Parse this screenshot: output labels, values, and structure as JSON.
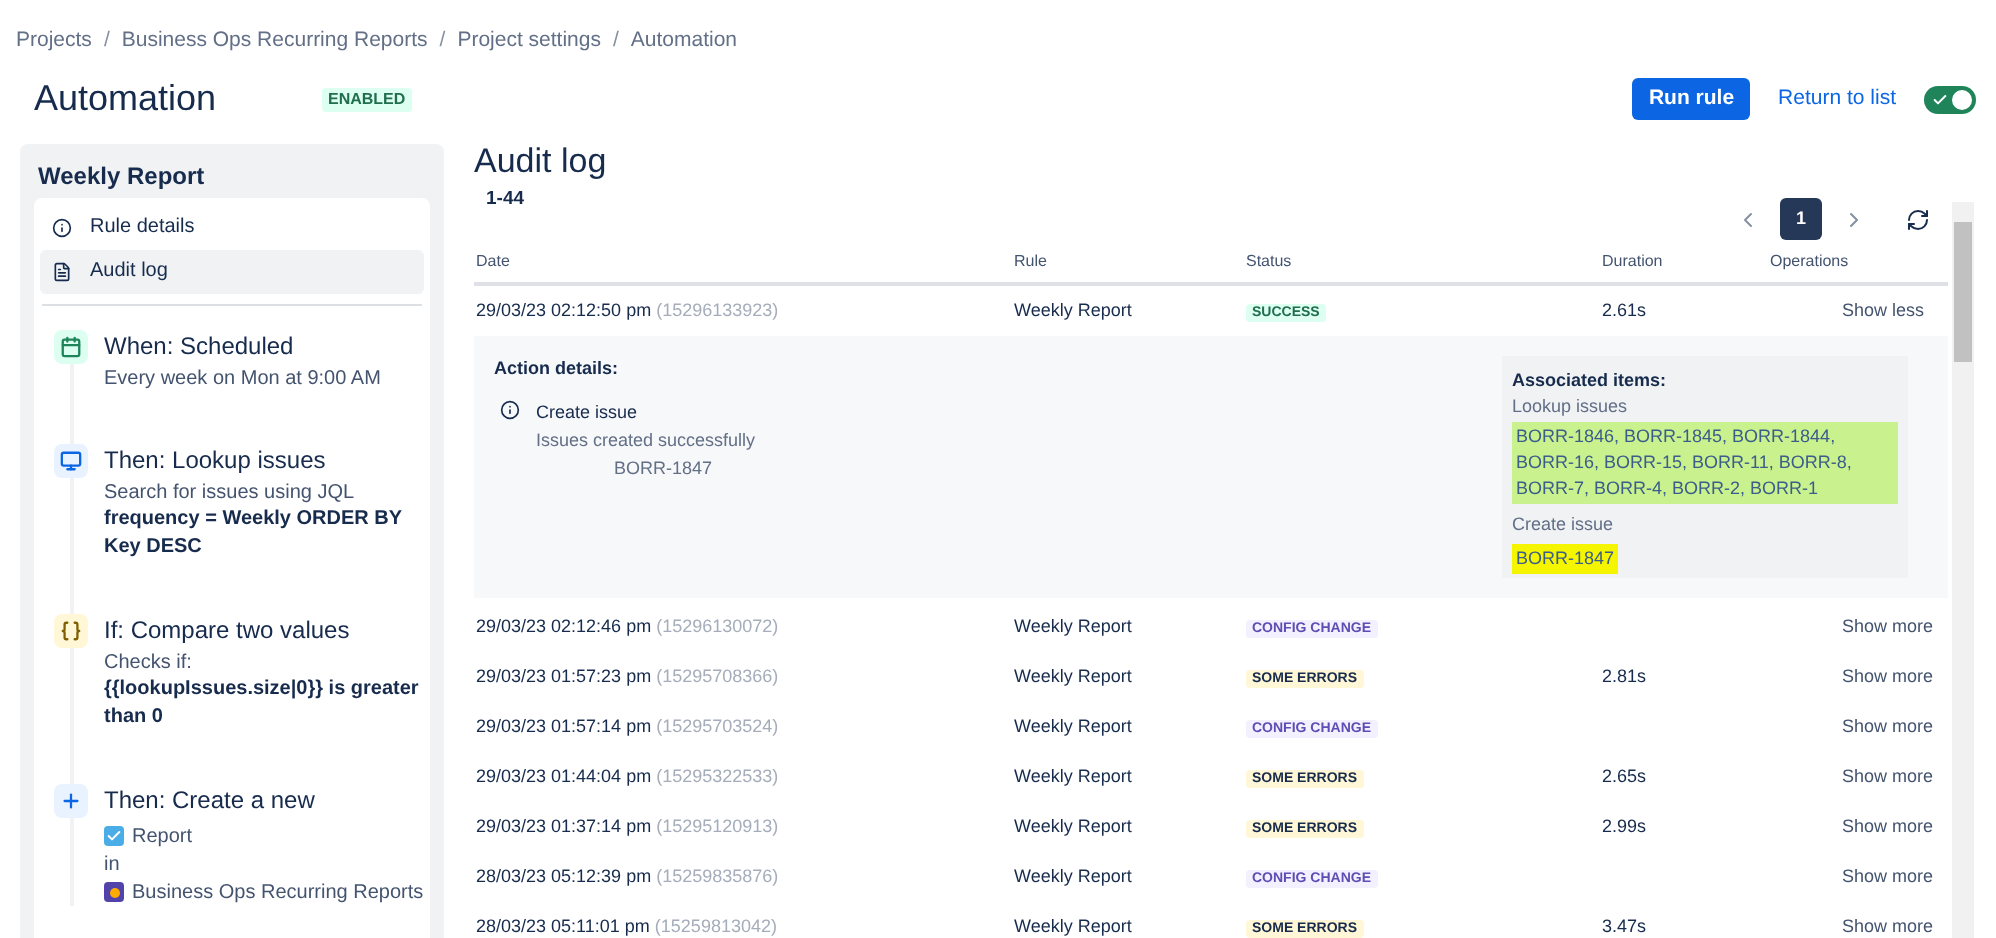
{
  "breadcrumbs": [
    "Projects",
    "Business Ops Recurring Reports",
    "Project settings",
    "Automation"
  ],
  "breadcrumb_separator": "/",
  "title": "Automation",
  "status_badge": "ENABLED",
  "actions": {
    "run_button": "Run rule",
    "return_link": "Return to list",
    "toggle_on": true
  },
  "sidebar": {
    "title": "Weekly Report",
    "nav": [
      {
        "label": "Rule details",
        "kind": "info",
        "selected": false
      },
      {
        "label": "Audit log",
        "kind": "log",
        "selected": true
      }
    ],
    "steps": [
      {
        "kind": "trigger",
        "title": "When: Scheduled",
        "lines": [
          "Every week on Mon at 9:00 AM"
        ]
      },
      {
        "kind": "lookup",
        "title": "Then: Lookup issues",
        "lines": [
          "Search for issues using JQL"
        ],
        "bold": "frequency = Weekly ORDER BY Key DESC"
      },
      {
        "kind": "condition",
        "title": "If: Compare two values",
        "lines": [
          "Checks if:"
        ],
        "bold": "{{lookupIssues.size|0}} is greater than 0"
      },
      {
        "kind": "create",
        "title": "Then: Create a new",
        "issue_type": "Report",
        "in": "in",
        "project": "Business Ops Recurring Reports"
      }
    ]
  },
  "audit": {
    "title": "Audit log",
    "range": "1-44",
    "pagination": {
      "pages": [
        {
          "label": "1",
          "selected": true
        }
      ]
    },
    "columns": [
      "Date",
      "Rule",
      "Status",
      "Duration",
      "Operations"
    ],
    "rows": [
      {
        "date": "29/03/23 02:12:50 pm",
        "id": "(15296133923)",
        "rule": "Weekly Report",
        "status": "SUCCESS",
        "kind": "success",
        "duration": "2.61s",
        "operation": "Show less",
        "details": {
          "heading": "Action details:",
          "action": "Create issue",
          "message": "Issues created successfully",
          "issue": "BORR-1847",
          "associated": {
            "heading": "Associated items:",
            "groups": [
              {
                "label": "Lookup issues",
                "items": "BORR-1846, BORR-1845, BORR-1844, BORR-16, BORR-15, BORR-11, BORR-8, BORR-7, BORR-4, BORR-2, BORR-1",
                "kind": "lookup"
              },
              {
                "label": "Create issue",
                "items": "BORR-1847",
                "kind": "create"
              }
            ]
          }
        }
      },
      {
        "date": "29/03/23 02:12:46 pm",
        "id": "(15296130072)",
        "rule": "Weekly Report",
        "status": "CONFIG CHANGE",
        "kind": "config",
        "operation": "Show more"
      },
      {
        "date": "29/03/23 01:57:23 pm",
        "id": "(15295708366)",
        "rule": "Weekly Report",
        "status": "SOME ERRORS",
        "kind": "errors",
        "duration": "2.81s",
        "operation": "Show more"
      },
      {
        "date": "29/03/23 01:57:14 pm",
        "id": "(15295703524)",
        "rule": "Weekly Report",
        "status": "CONFIG CHANGE",
        "kind": "config",
        "operation": "Show more"
      },
      {
        "date": "29/03/23 01:44:04 pm",
        "id": "(15295322533)",
        "rule": "Weekly Report",
        "status": "SOME ERRORS",
        "kind": "errors",
        "duration": "2.65s",
        "operation": "Show more"
      },
      {
        "date": "29/03/23 01:37:14 pm",
        "id": "(15295120913)",
        "rule": "Weekly Report",
        "status": "SOME ERRORS",
        "kind": "errors",
        "duration": "2.99s",
        "operation": "Show more"
      },
      {
        "date": "28/03/23 05:12:39 pm",
        "id": "(15259835876)",
        "rule": "Weekly Report",
        "status": "CONFIG CHANGE",
        "kind": "config",
        "operation": "Show more"
      },
      {
        "date": "28/03/23 05:11:01 pm",
        "id": "(15259813042)",
        "rule": "Weekly Report",
        "status": "SOME ERRORS",
        "kind": "errors",
        "duration": "3.47s",
        "operation": "Show more"
      }
    ]
  }
}
